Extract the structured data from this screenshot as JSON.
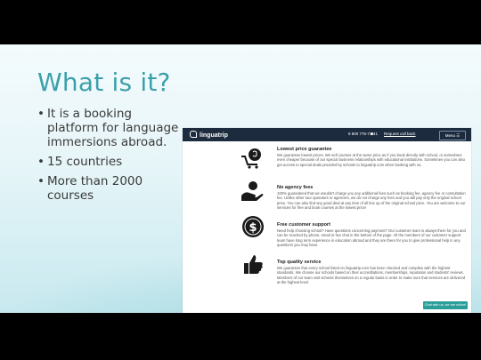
{
  "slide": {
    "title": "What is it?",
    "bullets": [
      "It is a booking platform for language immersions abroad.",
      "15 countries",
      "More than 2000 courses"
    ]
  },
  "screenshot": {
    "nav": {
      "logo": "linguatrip",
      "phone": "8 800 775-71-41",
      "callback": "Request call back",
      "menu_label": "Menu"
    },
    "features": [
      {
        "icon": "shopping-cart-icon",
        "heading": "Lowest price guarantee",
        "text": "We guarantee lowest prices. We sell courses at the same price as if you book directly with school, or sometimes even cheaper because of our special business relationships with educational institutions. Sometimes you can also get access to special deals provided by schools to linguatrip.com when booking with us."
      },
      {
        "icon": "hand-coin-icon",
        "heading": "No agency fees",
        "text": "100% guaranteed that we wouldn't charge you any additional fees such as booking fee, agency fee or consultation fee. Unlike other tour operators or agencies, we do not charge any fees and you will pay only the original school price. You can also find any good deal at any time of all line up of the original school price. You are welcome to our services for free and book courses at the lowest price!"
      },
      {
        "icon": "dollar-circle-icon",
        "heading": "Free customer support",
        "text": "Need help choosing school? Have questions concerning payment? Our customer team is always there for you and can be reached by phone, email or live chat in the bottom of the page. All the members of our customer support team have long term experience in education abroad and they are there for you to give professional help in any questions you may have."
      },
      {
        "icon": "thumbs-up-icon",
        "heading": "Top quality service",
        "text": "We guarantee that every school listed on linguatrip.com has been checked and complies with the highest standards. We choose our schools based on their accreditations, memberships, reputation and students' reviews. Members of our team visit schools themselves on a regular basis in order to make sure that services are delivered at the highest level."
      }
    ],
    "chat_button": "Chat with us, we are online!"
  }
}
